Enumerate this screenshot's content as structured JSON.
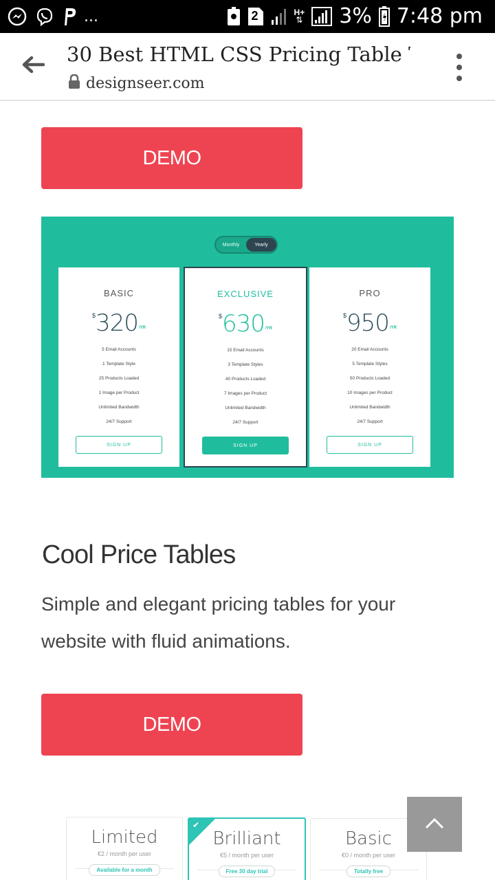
{
  "status_bar": {
    "left_icons": [
      "messenger-icon",
      "viber-icon",
      "parking-app-icon"
    ],
    "ellipsis": "...",
    "sim_badge": "2",
    "network_type": "H+",
    "battery": "3%",
    "time": "7:48 pm"
  },
  "browser": {
    "title": "30 Best HTML CSS Pricing Table T...",
    "url": "designseer.com"
  },
  "buttons": {
    "demo1": "DEMO",
    "demo2": "DEMO"
  },
  "preview1": {
    "toggle": {
      "monthly": "Monthly",
      "yearly": "Yearly",
      "selected": "Yearly"
    },
    "plans": [
      {
        "name": "BASIC",
        "currency": "$",
        "price": "320",
        "period": "/YR",
        "features": [
          "5 Email Accounts",
          "1 Template Style",
          "25 Products Loaded",
          "1 Image per Product",
          "Unlimited Bandwidth",
          "24/7 Support"
        ],
        "cta": "SIGN UP"
      },
      {
        "name": "EXCLUSIVE",
        "currency": "$",
        "price": "630",
        "period": "/YR",
        "features": [
          "15 Email Accounts",
          "3 Template Styles",
          "40 Products Loaded",
          "7 Images per Product",
          "Unlimited Bandwidth",
          "24/7 Support"
        ],
        "cta": "SIGN UP"
      },
      {
        "name": "PRO",
        "currency": "$",
        "price": "950",
        "period": "/YR",
        "features": [
          "20 Email Accounts",
          "5 Template Styles",
          "50 Products Loaded",
          "10 Images per Product",
          "Unlimited Bandwidth",
          "24/7 Support"
        ],
        "cta": "SIGN UP"
      }
    ]
  },
  "section": {
    "title": "Cool Price Tables",
    "description": "Simple and elegant pricing tables for your website with fluid animations."
  },
  "preview2": {
    "plans": [
      {
        "name": "Limited",
        "price": "€2 / month per user",
        "badge": "Available for a month"
      },
      {
        "name": "Brilliant",
        "price": "€5 / month per user",
        "badge": "Free 30 day trial"
      },
      {
        "name": "Basic",
        "price": "€0 / month per user",
        "badge": "Totally free"
      }
    ]
  },
  "colors": {
    "demo_button": "#ee4452",
    "teal": "#1fbd9d",
    "dark_slate": "#2c4550"
  }
}
